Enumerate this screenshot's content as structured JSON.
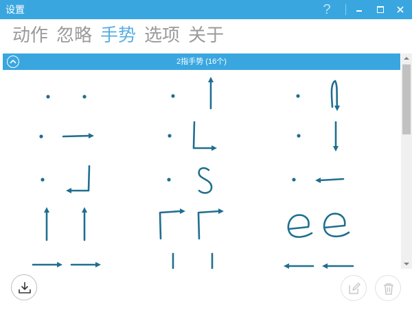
{
  "window": {
    "title": "设置",
    "help_label": "?"
  },
  "tabs": [
    {
      "label": "动作",
      "active": false
    },
    {
      "label": "忽略",
      "active": false
    },
    {
      "label": "手势",
      "active": true
    },
    {
      "label": "选项",
      "active": false
    },
    {
      "label": "关于",
      "active": false
    }
  ],
  "section": {
    "title": "2指手势 (16个)"
  },
  "gestures": [
    {
      "name": "two-dots"
    },
    {
      "name": "dot-and-vertical-up"
    },
    {
      "name": "dot-and-hook-up"
    },
    {
      "name": "dot-and-right-arrow"
    },
    {
      "name": "dot-and-l-shape"
    },
    {
      "name": "dot-and-vertical-down"
    },
    {
      "name": "dot-and-hook-left"
    },
    {
      "name": "dot-and-s-shape"
    },
    {
      "name": "dot-and-left-arrow"
    },
    {
      "name": "two-up-arrows"
    },
    {
      "name": "two-corner-right-down"
    },
    {
      "name": "two-e-shapes"
    },
    {
      "name": "two-right-arrows"
    },
    {
      "name": "two-vertical-lines"
    },
    {
      "name": "two-left-arrows"
    }
  ],
  "icons": {
    "download": "download-icon",
    "edit": "edit-icon",
    "delete": "trash-icon",
    "collapse": "chevron-up-icon"
  },
  "colors": {
    "accent": "#3aa6e0",
    "active_tab": "#58aee2",
    "inactive_tab": "#9a9a9a",
    "stroke": "#1f6e8f"
  }
}
